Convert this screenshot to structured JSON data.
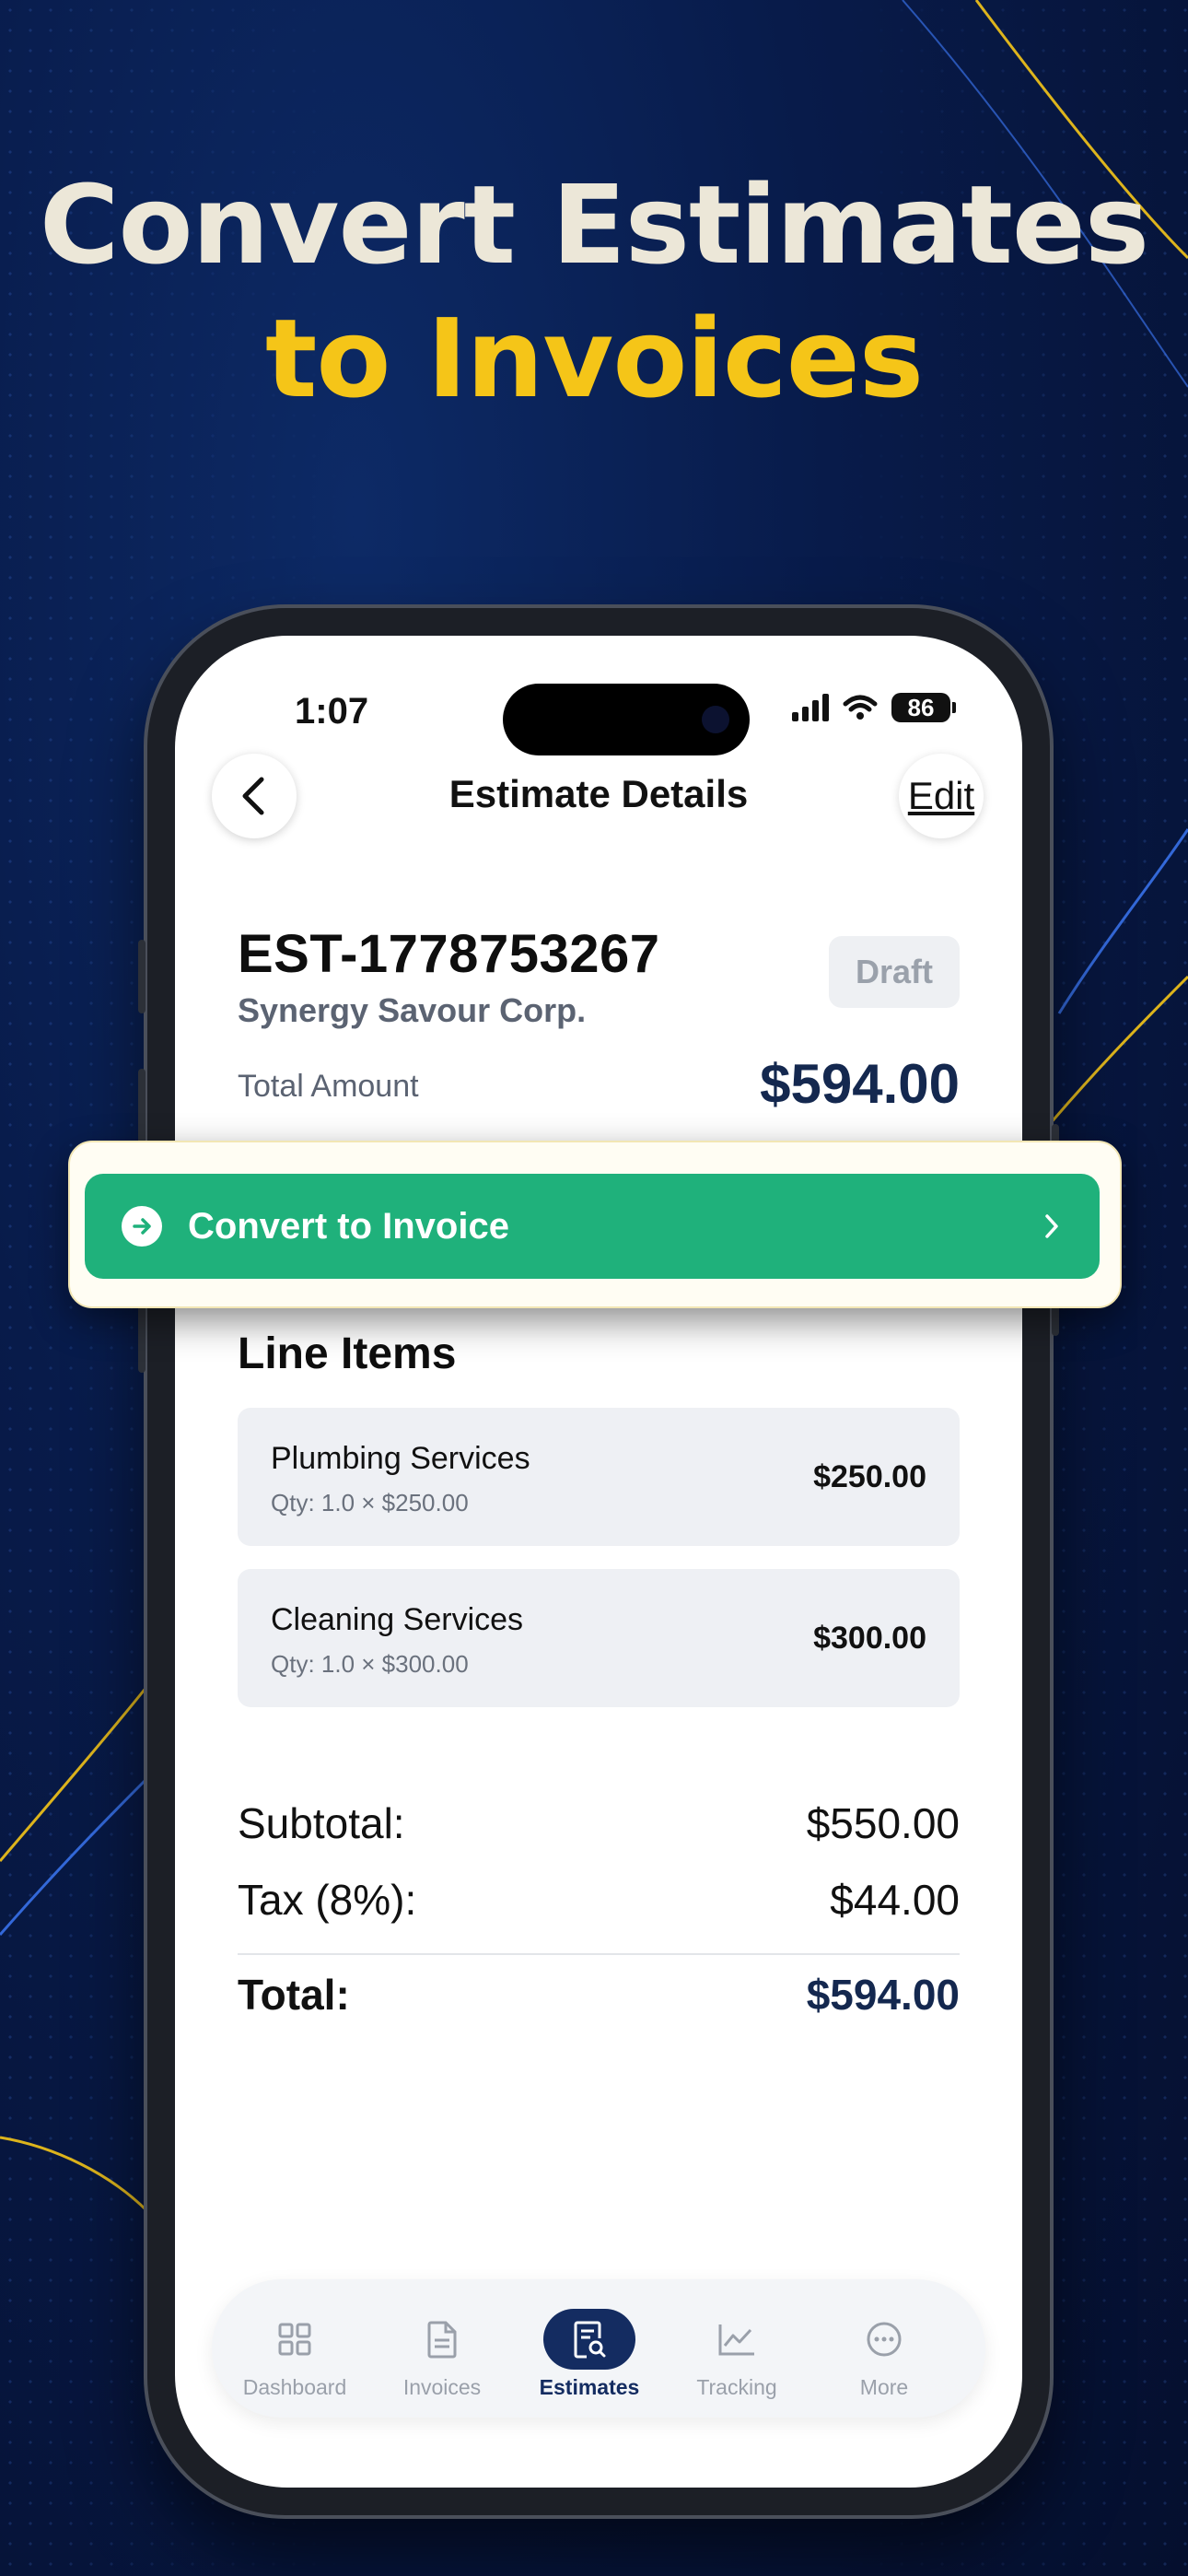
{
  "headline": {
    "line1": "Convert Estimates",
    "line2": "to Invoices"
  },
  "status_bar": {
    "time": "1:07",
    "battery": "86"
  },
  "nav": {
    "title": "Estimate Details",
    "edit_label": "Edit"
  },
  "estimate": {
    "number": "EST-1778753267",
    "client": "Synergy Savour Corp.",
    "status": "Draft",
    "total_label": "Total Amount",
    "total_value": "$594.00"
  },
  "convert": {
    "label": "Convert to Invoice"
  },
  "line_items": {
    "title": "Line Items",
    "items": [
      {
        "name": "Plumbing Services",
        "qty": "Qty: 1.0 × $250.00",
        "amount": "$250.00"
      },
      {
        "name": "Cleaning Services",
        "qty": "Qty: 1.0 × $300.00",
        "amount": "$300.00"
      }
    ]
  },
  "summary": {
    "subtotal_label": "Subtotal:",
    "subtotal_value": "$550.00",
    "tax_label": "Tax (8%):",
    "tax_value": "$44.00",
    "total_label": "Total:",
    "total_value": "$594.00"
  },
  "tabs": [
    {
      "label": "Dashboard",
      "icon": "grid-icon",
      "active": false
    },
    {
      "label": "Invoices",
      "icon": "document-icon",
      "active": false
    },
    {
      "label": "Estimates",
      "icon": "estimate-search-icon",
      "active": true
    },
    {
      "label": "Tracking",
      "icon": "chart-icon",
      "active": false
    },
    {
      "label": "More",
      "icon": "more-icon",
      "active": false
    }
  ],
  "colors": {
    "headline_primary": "#ece7d8",
    "headline_accent": "#f5c518",
    "convert_green": "#1fb17b",
    "navy": "#14284f"
  }
}
